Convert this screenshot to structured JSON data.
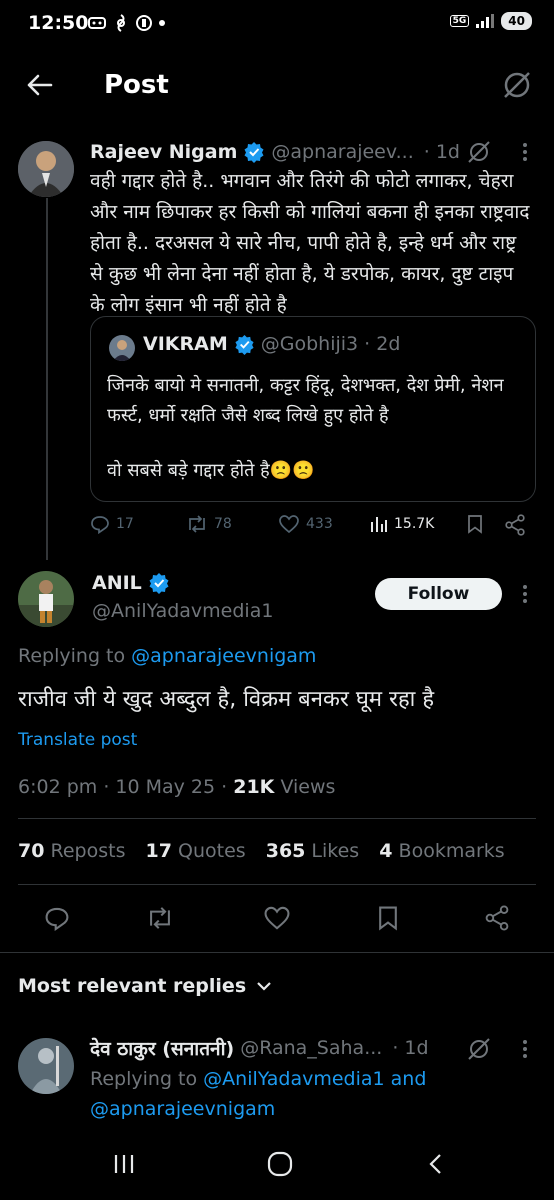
{
  "status_bar": {
    "time": "12:50",
    "network": "5G",
    "battery": "40"
  },
  "header": {
    "title": "Post"
  },
  "parent_post": {
    "name": "Rajeev Nigam",
    "handle": "@apnarajeev...",
    "time": "· 1d",
    "text": "वही गद्दार होते है.. भगवान और तिरंगे की फोटो लगाकर, चेहरा और नाम छिपाकर हर किसी को गालियां बकना ही इनका राष्ट्रवाद होता है.. दरअसल ये सारे नीच, पापी होते है, इन्हे धर्म और राष्ट्र से कुछ भी लेना देना नहीं होता है, ये डरपोक, कायर, दुष्ट टाइप के लोग इंसान भी नहीं होते है",
    "quote": {
      "name": "VIKRAM",
      "handle": "@Gobhiji3 · 2d",
      "text": "जिनके बायो मे सनातनी, कट्टर हिंदू, देशभक्त, देश प्रेमी, नेशन फर्स्ट, धर्मो रक्षति जैसे शब्द लिखे हुए होते है",
      "text2": "वो सबसे बड़े  गद्दार होते है🙁🙁"
    },
    "actions": {
      "replies": "17",
      "reposts": "78",
      "likes": "433",
      "views": "15.7K"
    }
  },
  "main_post": {
    "name": "ANIL",
    "handle": "@AnilYadavmedia1",
    "follow_label": "Follow",
    "replying_prefix": "Replying to ",
    "replying_to": "@apnarajeevnigam",
    "text": "राजीव जी ये खुद अब्दुल है, विक्रम बनकर घूम रहा है",
    "translate": "Translate post",
    "timestamp": "6:02 pm · 10 May 25 · ",
    "views_count": "21K",
    "views_label": " Views",
    "stats": {
      "reposts_count": "70",
      "reposts_label": " Reposts",
      "quotes_count": "17",
      "quotes_label": " Quotes",
      "likes_count": "365",
      "likes_label": " Likes",
      "bookmarks_count": "4",
      "bookmarks_label": " Bookmarks"
    }
  },
  "replies_sort": {
    "label": "Most relevant replies"
  },
  "reply": {
    "name": "देव ठाकुर (सनातनी)",
    "handle": "@Rana_Saha...",
    "time": "· 1d",
    "replying_prefix": "Replying to ",
    "replying_to_1": "@AnilYadavmedia1",
    "and": " and",
    "replying_to_2": "@apnarajeevnigam"
  },
  "colors": {
    "background": "#000000",
    "accent": "#1d9bf0",
    "text": "#e7e9ea",
    "muted": "#71767b",
    "divider": "#2f3336"
  },
  "icons": [
    "back-arrow-icon",
    "grok-icon",
    "verified-icon",
    "more-icon",
    "reply-icon",
    "repost-icon",
    "like-icon",
    "views-icon",
    "bookmark-icon",
    "share-icon",
    "chevron-down-icon"
  ]
}
